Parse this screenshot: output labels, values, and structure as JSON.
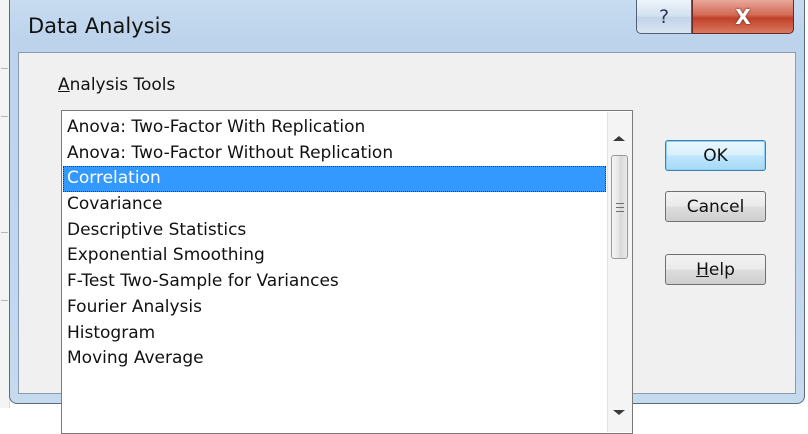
{
  "window": {
    "title": "Data Analysis",
    "help_glyph": "?",
    "close_glyph": "X"
  },
  "group": {
    "label": "Analysis Tools",
    "mnemonic": "A"
  },
  "list": {
    "items": [
      "Anova: Two-Factor With Replication",
      "Anova: Two-Factor Without Replication",
      "Correlation",
      "Covariance",
      "Descriptive Statistics",
      "Exponential Smoothing",
      "F-Test Two-Sample for Variances",
      "Fourier Analysis",
      "Histogram",
      "Moving Average"
    ],
    "selected": "Correlation"
  },
  "buttons": {
    "ok": "OK",
    "cancel": "Cancel",
    "help": "Help",
    "help_mnemonic": "H"
  },
  "colors": {
    "selection": "#3399ff",
    "frame": "#c3d8ef",
    "close": "#c7452f"
  }
}
